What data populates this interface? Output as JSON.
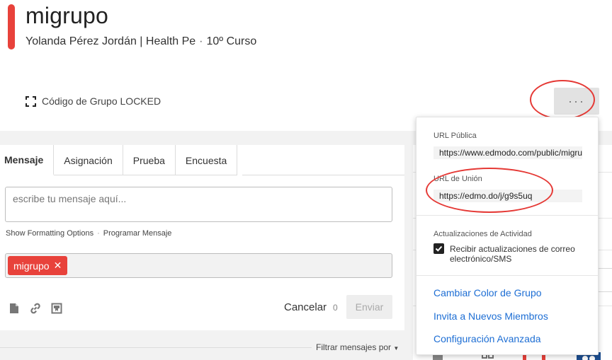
{
  "group": {
    "name": "migrupo",
    "owner": "Yolanda Pérez Jordán | Health Pe",
    "grade": "10º Curso",
    "code_label": "Código de Grupo LOCKED",
    "accent_color": "#e8423b"
  },
  "header": {
    "more_label": "···"
  },
  "composer": {
    "tabs": [
      "Mensaje",
      "Asignación",
      "Prueba",
      "Encuesta"
    ],
    "message_placeholder": "escribe tu mensaje aquí...",
    "format_options": "Show Formatting Options",
    "schedule": "Programar Mensaje",
    "recipient_chip": "migrupo",
    "cancel_label": "Cancelar",
    "char_count": "0",
    "send_label": "Enviar",
    "tool_icons": [
      "file-icon",
      "link-icon",
      "library-icon"
    ]
  },
  "filter": {
    "label": "Filtrar mensajes por"
  },
  "dropdown": {
    "public_url_label": "URL Pública",
    "public_url_value": "https://www.edmodo.com/public/migrupo",
    "join_url_label": "URL de Unión",
    "join_url_value": "https://edmo.do/j/g9s5uq",
    "updates_label": "Actualizaciones de Actividad",
    "updates_checkbox_label": "Recibir actualizaciones de correo electrónico/SMS",
    "updates_checked": true,
    "links": [
      "Cambiar Color de Grupo",
      "Invita a Nuevos Miembros",
      "Configuración Avanzada"
    ]
  },
  "colors": {
    "link": "#1d6ed4",
    "annotation": "#e53935",
    "accent": "#e8423b"
  }
}
